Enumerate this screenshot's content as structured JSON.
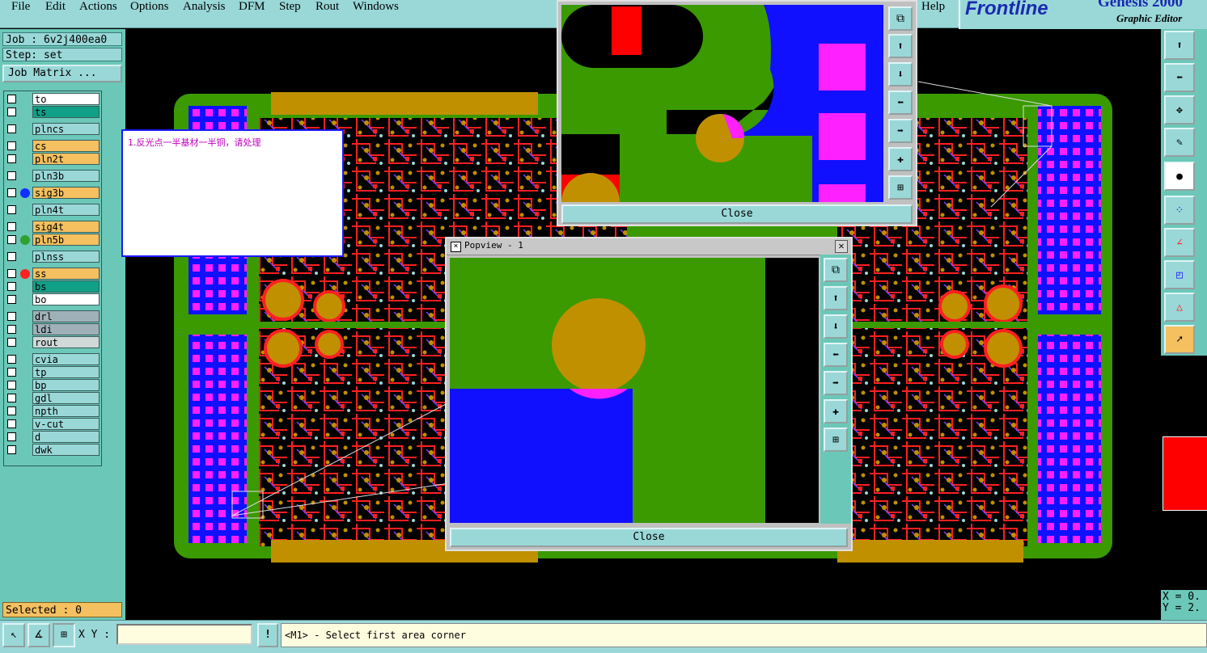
{
  "menu": [
    "File",
    "Edit",
    "Actions",
    "Options",
    "Analysis",
    "DFM",
    "Step",
    "Rout",
    "Windows",
    "Help"
  ],
  "brand": {
    "logo": "Frontline",
    "product": "Genesis 2000",
    "subtitle": "Graphic Editor"
  },
  "job": {
    "job_label": "Job : 6v2j400ea0",
    "step_label": "Step: set",
    "matrix_button": "Job Matrix ..."
  },
  "layers": [
    {
      "name": "to",
      "color": "#ffffff",
      "dot": ""
    },
    {
      "name": "ts",
      "color": "#10a088",
      "dot": ""
    },
    {
      "name": "plncs",
      "color": "#9ad8d8",
      "dot": ""
    },
    {
      "name": "cs",
      "color": "#f4c060",
      "dot": ""
    },
    {
      "name": "pln2t",
      "color": "#f4c060",
      "dot": ""
    },
    {
      "name": "pln3b",
      "color": "#9ad8d8",
      "dot": ""
    },
    {
      "name": "sig3b",
      "color": "#f4c060",
      "dot": "#1030ff"
    },
    {
      "name": "pln4t",
      "color": "#9ad8d8",
      "dot": ""
    },
    {
      "name": "sig4t",
      "color": "#f4c060",
      "dot": ""
    },
    {
      "name": "pln5b",
      "color": "#f4c060",
      "dot": "#30a030"
    },
    {
      "name": "plnss",
      "color": "#9ad8d8",
      "dot": ""
    },
    {
      "name": "ss",
      "color": "#f4c060",
      "dot": "#ff2020"
    },
    {
      "name": "bs",
      "color": "#10a088",
      "dot": ""
    },
    {
      "name": "bo",
      "color": "#ffffff",
      "dot": ""
    },
    {
      "name": "drl",
      "color": "#a0b0b8",
      "dot": ""
    },
    {
      "name": "ldi",
      "color": "#a0b0b8",
      "dot": ""
    },
    {
      "name": "rout",
      "color": "#d0d8d8",
      "dot": ""
    },
    {
      "name": "cvia",
      "color": "#9ad8d8",
      "dot": ""
    },
    {
      "name": "tp",
      "color": "#9ad8d8",
      "dot": ""
    },
    {
      "name": "bp",
      "color": "#9ad8d8",
      "dot": ""
    },
    {
      "name": "gdl",
      "color": "#9ad8d8",
      "dot": ""
    },
    {
      "name": "npth",
      "color": "#9ad8d8",
      "dot": ""
    },
    {
      "name": "v-cut",
      "color": "#9ad8d8",
      "dot": ""
    },
    {
      "name": "d",
      "color": "#9ad8d8",
      "dot": ""
    },
    {
      "name": "dwk",
      "color": "#9ad8d8",
      "dot": ""
    }
  ],
  "selected_label": "Selected : 0",
  "comment_text": "1.反光点一半基材一半铜，请处理",
  "popview1": {
    "title": "Popview - 1",
    "close": "Close"
  },
  "popview2": {
    "close": "Close"
  },
  "coords": {
    "x": "X = 0.",
    "y": "Y = 2."
  },
  "status": {
    "xy_label": "X Y :",
    "xy_value": "",
    "xy_placeholder": "",
    "prompt": "<M1> - Select first area corner",
    "alert": "!"
  },
  "colors": {
    "panel": "#9ad8d8",
    "copper": "#3a9a00",
    "pad": "#c09000",
    "blue": "#1010ff",
    "magenta": "#ff20ff",
    "trace": "#ff2020"
  }
}
